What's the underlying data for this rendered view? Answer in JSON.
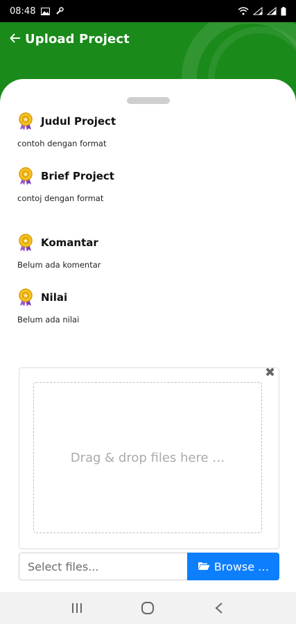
{
  "status_bar": {
    "time": "08:48"
  },
  "header": {
    "title": "Upload Project",
    "color": "#1a8a1a"
  },
  "sections": [
    {
      "title": "Judul Project",
      "desc": "contoh dengan format"
    },
    {
      "title": "Brief Project",
      "desc": "contoj dengan format"
    },
    {
      "title": "Komantar",
      "desc": "Belum ada komentar"
    },
    {
      "title": "Nilai",
      "desc": "Belum ada nilai"
    }
  ],
  "upload": {
    "drop_text": "Drag & drop files here …",
    "file_placeholder": "Select files...",
    "browse_label": "Browse …",
    "accent": "#0d7efc"
  },
  "icons": {
    "medal": "medal-icon",
    "back": "back-arrow-icon",
    "close": "close-icon",
    "folder": "folder-open-icon"
  }
}
